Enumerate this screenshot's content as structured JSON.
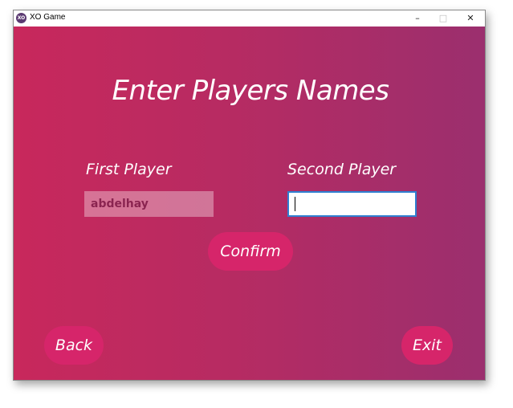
{
  "window": {
    "title": "XO Game",
    "icon_label": "XO",
    "minimize_glyph": "–",
    "maximize_glyph": "□",
    "close_glyph": "✕"
  },
  "screen": {
    "heading": "Enter Players Names",
    "first_player": {
      "label": "First Player",
      "value": "abdelhay"
    },
    "second_player": {
      "label": "Second Player",
      "value": ""
    },
    "confirm_label": "Confirm",
    "back_label": "Back",
    "exit_label": "Exit"
  },
  "colors": {
    "gradient_start": "#c8285c",
    "gradient_end": "#9b2f6e",
    "button": "#d6256a",
    "focus_border": "#2f7fd1"
  }
}
